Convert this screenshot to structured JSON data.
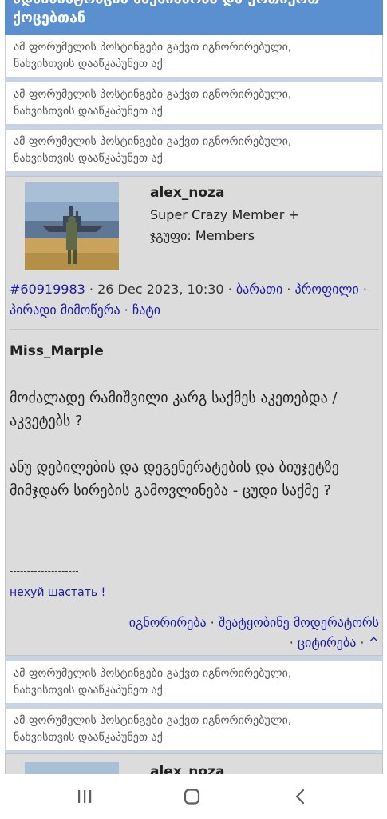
{
  "header": {
    "title_line1": "ადმინისტრაცია საქმიანობა და ურთიერთ",
    "title_line2": "ქოცებთან"
  },
  "ignored_notice": {
    "line1": "ამ ფორუმელის პოსტინგები გაქვთ იგნორირებული,",
    "line2": "ნახვისთვის დააწკაპუნეთ აქ"
  },
  "post": {
    "username": "alex_noza",
    "rank": "Super Crazy Member +",
    "group": "ჯგუფი: Members",
    "post_id": "#60919983",
    "sep": " · ",
    "timestamp": "26 Dec 2023, 10:30",
    "links": {
      "card": "ბარათი",
      "profile": "პროფილი",
      "pm": "პირადი მიმოწერა",
      "chat": "ჩატი"
    },
    "quoted_user": "Miss_Marple",
    "paragraph1": "მოძალადე რამიშვილი კარგ საქმეს აკეთებდა / აკვეტებს ?",
    "paragraph2": "ანუ დებილების და დეგენერატების და ბიუჯეტზე მიმჯდარ სირების გამოვლინება - ცუდი საქმე ?",
    "signature_line": "--------------------",
    "signature": "нехуй шастать !",
    "actions": {
      "ignore": "იგნორირება",
      "report": "შეატყობინე მოდერატორს",
      "quote": "ციტირება",
      "top": "^"
    }
  },
  "next_post": {
    "username": "alex_noza"
  },
  "navbar": {
    "recents": "recents-icon",
    "home": "home-icon",
    "back": "back-icon"
  },
  "colors": {
    "header_blue": "#5a8fd0",
    "link_blue": "#1a1aa6",
    "post_bg": "#dcdcdc",
    "separator": "#c8d4e4"
  }
}
